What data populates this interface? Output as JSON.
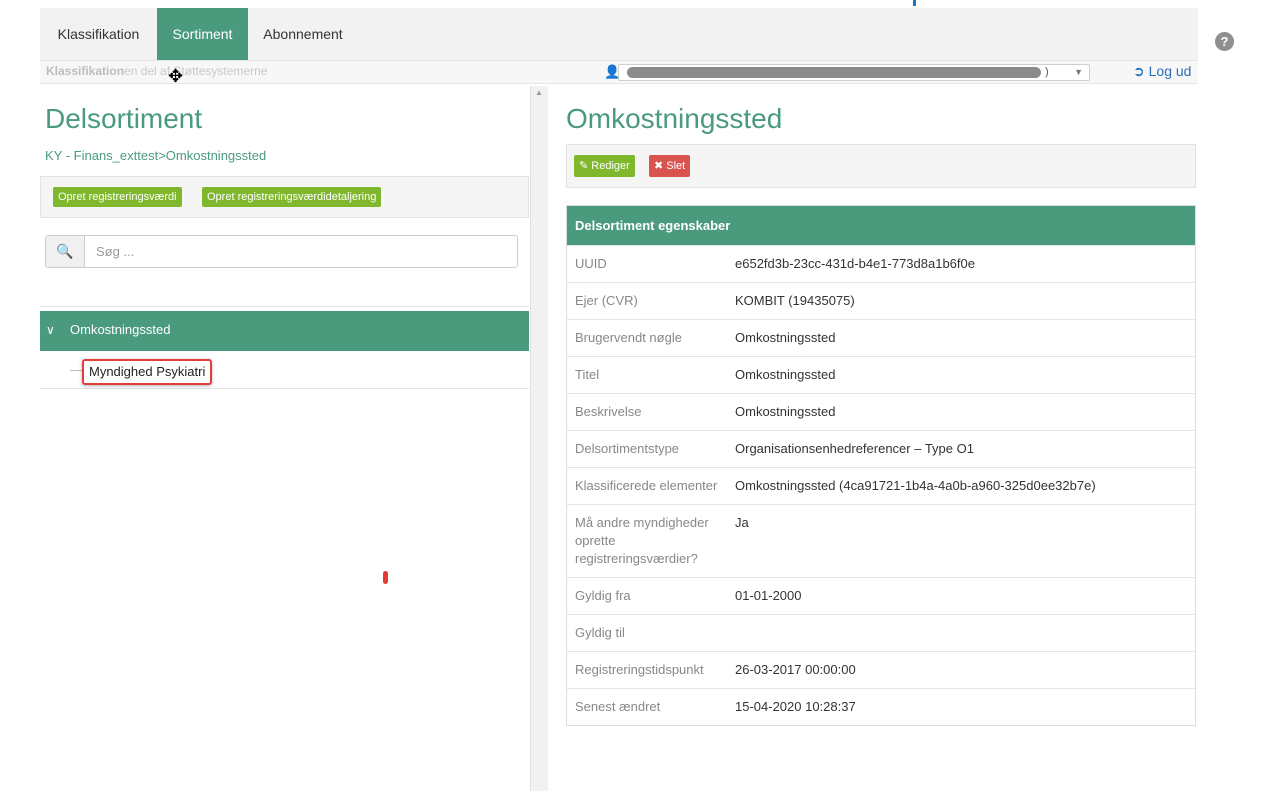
{
  "nav": {
    "tabs": [
      {
        "label": "Klassifikation",
        "active": false
      },
      {
        "label": "Sortiment",
        "active": true
      },
      {
        "label": "Abonnement",
        "active": false
      }
    ],
    "help_icon": "?",
    "accent_color": "#4a9a7e"
  },
  "subbar": {
    "title_bold": "Klassifikation",
    "title_rest": "en del af Støttesystemerne",
    "user_value": ") ",
    "logout_label": "Log ud"
  },
  "left": {
    "heading": "Delsortiment",
    "breadcrumb": "KY - Finans_exttest>Omkostningssted",
    "buttons": {
      "create_value": "Opret registreringsværdi",
      "create_detail": "Opret registreringsværdidetaljering"
    },
    "search": {
      "placeholder": "Søg ..."
    },
    "tree": {
      "root_label": "Omkostningssted",
      "child_label": "Myndighed Psykiatri"
    }
  },
  "right": {
    "heading": "Omkostningssted",
    "buttons": {
      "edit": "Rediger",
      "delete": "Slet"
    },
    "panel_title": "Delsortiment egenskaber",
    "rows": [
      {
        "k": "UUID",
        "v": "e652fd3b-23cc-431d-b4e1-773d8a1b6f0e"
      },
      {
        "k": "Ejer (CVR)",
        "v": "KOMBIT (19435075)"
      },
      {
        "k": "Brugervendt nøgle",
        "v": "Omkostningssted"
      },
      {
        "k": "Titel",
        "v": "Omkostningssted"
      },
      {
        "k": "Beskrivelse",
        "v": "Omkostningssted"
      },
      {
        "k": "Delsortimentstype",
        "v": "Organisationsenhedreferencer – Type O1"
      },
      {
        "k": "Klassificerede elementer",
        "v": "Omkostningssted (4ca91721-1b4a-4a0b-a960-325d0ee32b7e)"
      },
      {
        "k": "Må andre myndigheder oprette registreringsværdier?",
        "v": "Ja"
      },
      {
        "k": "Gyldig fra",
        "v": "01-01-2000"
      },
      {
        "k": "Gyldig til",
        "v": ""
      },
      {
        "k": "Registreringstidspunkt",
        "v": "26-03-2017 00:00:00"
      },
      {
        "k": "Senest ændret",
        "v": "15-04-2020 10:28:37"
      }
    ]
  }
}
